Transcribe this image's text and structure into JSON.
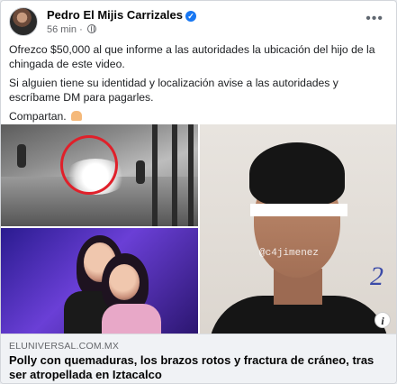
{
  "post": {
    "author": "Pedro El Mijis Carrizales",
    "verified_icon": "verified-badge-icon",
    "time": "56 min",
    "audience_icon": "globe-icon",
    "more_label": "•••",
    "paragraphs": [
      "Ofrezco $50,000 al que informe a las autoridades la ubicación del hijo de la chingada de este video.",
      "Si alguien tiene su identidad y localización avise a las autoridades y escríbame DM para pagarles.",
      "Compartan."
    ],
    "emoji_icon": "folded-hands-icon"
  },
  "media": {
    "images": [
      {
        "name": "cctv-still",
        "description_icon": "cctv-photo"
      },
      {
        "name": "party-photo",
        "description_icon": "party-photo"
      },
      {
        "name": "mugshot-photo",
        "description_icon": "mugshot-photo"
      }
    ],
    "watermark": "@c4jimenez",
    "handwritten_mark": "2",
    "info_label": "i"
  },
  "link": {
    "domain": "ELUNIVERSAL.COM.MX",
    "title": "Polly con quemaduras, los brazos rotos y fractura de cráneo, tras ser atropellada en Iztacalco"
  },
  "colors": {
    "accent": "#1877f2",
    "text": "#050505",
    "secondary_text": "#65676b",
    "link_bg": "#f0f2f5",
    "highlight_circle": "#e0202a"
  }
}
